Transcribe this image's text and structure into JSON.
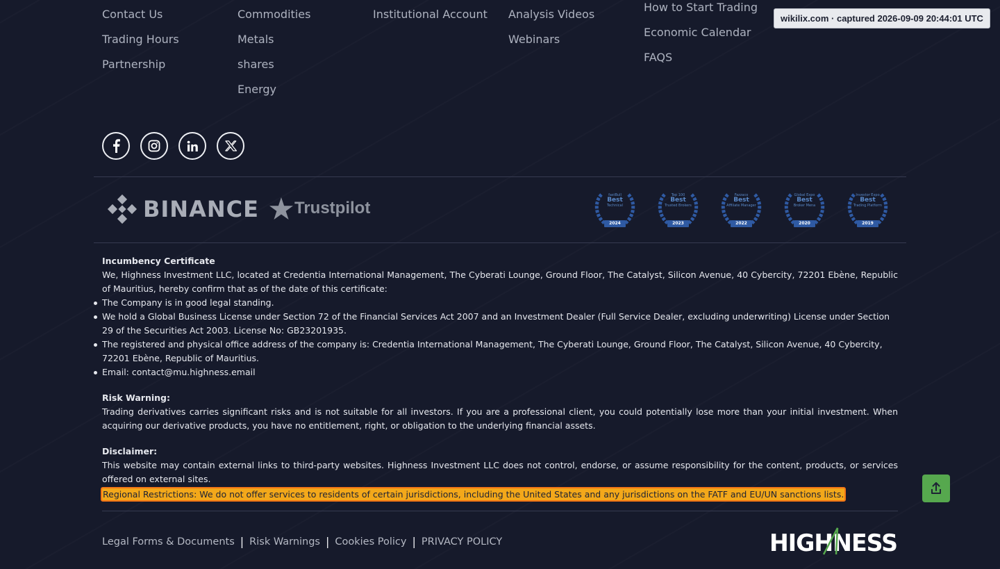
{
  "footer": {
    "columns": [
      [
        "Contact Us",
        "Trading Hours",
        "Partnership"
      ],
      [
        "Commodities",
        "Metals",
        "shares",
        "Energy"
      ],
      [
        "Institutional Account"
      ],
      [
        "Analysis Videos",
        "Webinars"
      ],
      [
        "How to Start Trading",
        "Economic Calendar",
        "FAQS"
      ]
    ]
  },
  "capture_banner": "wikilix.com · captured 2026-09-09 20:44:01 UTC",
  "socials": [
    "facebook-icon",
    "instagram-icon",
    "linkedin-icon",
    "x-twitter-icon"
  ],
  "partners": {
    "binance": "BINANCE",
    "trustpilot": "Trustpilot"
  },
  "awards": [
    {
      "line1": "fastBull",
      "line2": "Best",
      "line3": "Technical",
      "year": "2024"
    },
    {
      "line1": "Top 100",
      "line2": "Best",
      "line3": "Trusted Brokers",
      "year": "2023"
    },
    {
      "line1": "Fazzaco",
      "line2": "Best",
      "line3": "Affiliate Manager",
      "year": "2022"
    },
    {
      "line1": "Global Expo",
      "line2": "Best",
      "line3": "Broker Mena",
      "year": "2020"
    },
    {
      "line1": "Investor Expo",
      "line2": "Best",
      "line3": "Trading Platform",
      "year": "2019"
    }
  ],
  "legal": {
    "incumbency_title": "Incumbency Certificate",
    "incumbency_intro": "We, Highness Investment LLC, located at Credentia International Management, The Cyberati Lounge, Ground Floor, The Catalyst, Silicon Avenue, 40 Cybercity, 72201 Ebène, Republic of Mauritius, hereby confirm that as of the date of this certificate:",
    "bullets": [
      "The Company is in good legal standing.",
      "We hold a Global Business License under Section 72 of the Financial Services Act 2007 and an Investment Dealer (Full Service Dealer, excluding underwriting) License under Section 29 of the Securities Act 2003. License No: GB23201935.",
      "The registered and physical office address of the company is: Credentia International Management, The Cyberati Lounge, Ground Floor, The Catalyst, Silicon Avenue, 40 Cybercity, 72201 Ebène, Republic of Mauritius.",
      "Email: contact@mu.highness.email"
    ],
    "risk_title": "Risk Warning:",
    "risk_text": "Trading derivatives carries significant risks and is not suitable for all investors. If you are a professional client, you could potentially lose more than your initial investment. When acquiring our derivative products, you have no entitlement, right, or obligation to the underlying financial assets.",
    "disclaimer_title": "Disclaimer:",
    "disclaimer_text": "This website may contain external links to third-party websites. Highness Investment LLC does not control, endorse, or assume responsibility for the content, products, or services offered on external sites.",
    "regional": "Regional Restrictions: We do not offer services to residents of certain jurisdictions, including the United States and any jurisdictions on the FATF and EU/UN sanctions lists."
  },
  "bottom_links": [
    "Legal Forms & Documents",
    "Risk Warnings",
    "Cookies Policy",
    "PRIVACY POLICY"
  ],
  "logo": "HIGHNESS",
  "colors": {
    "background": "#161a2b",
    "highlight": "#f3a81a",
    "highlight_border": "#f27516",
    "to_top": "#56a84e"
  }
}
